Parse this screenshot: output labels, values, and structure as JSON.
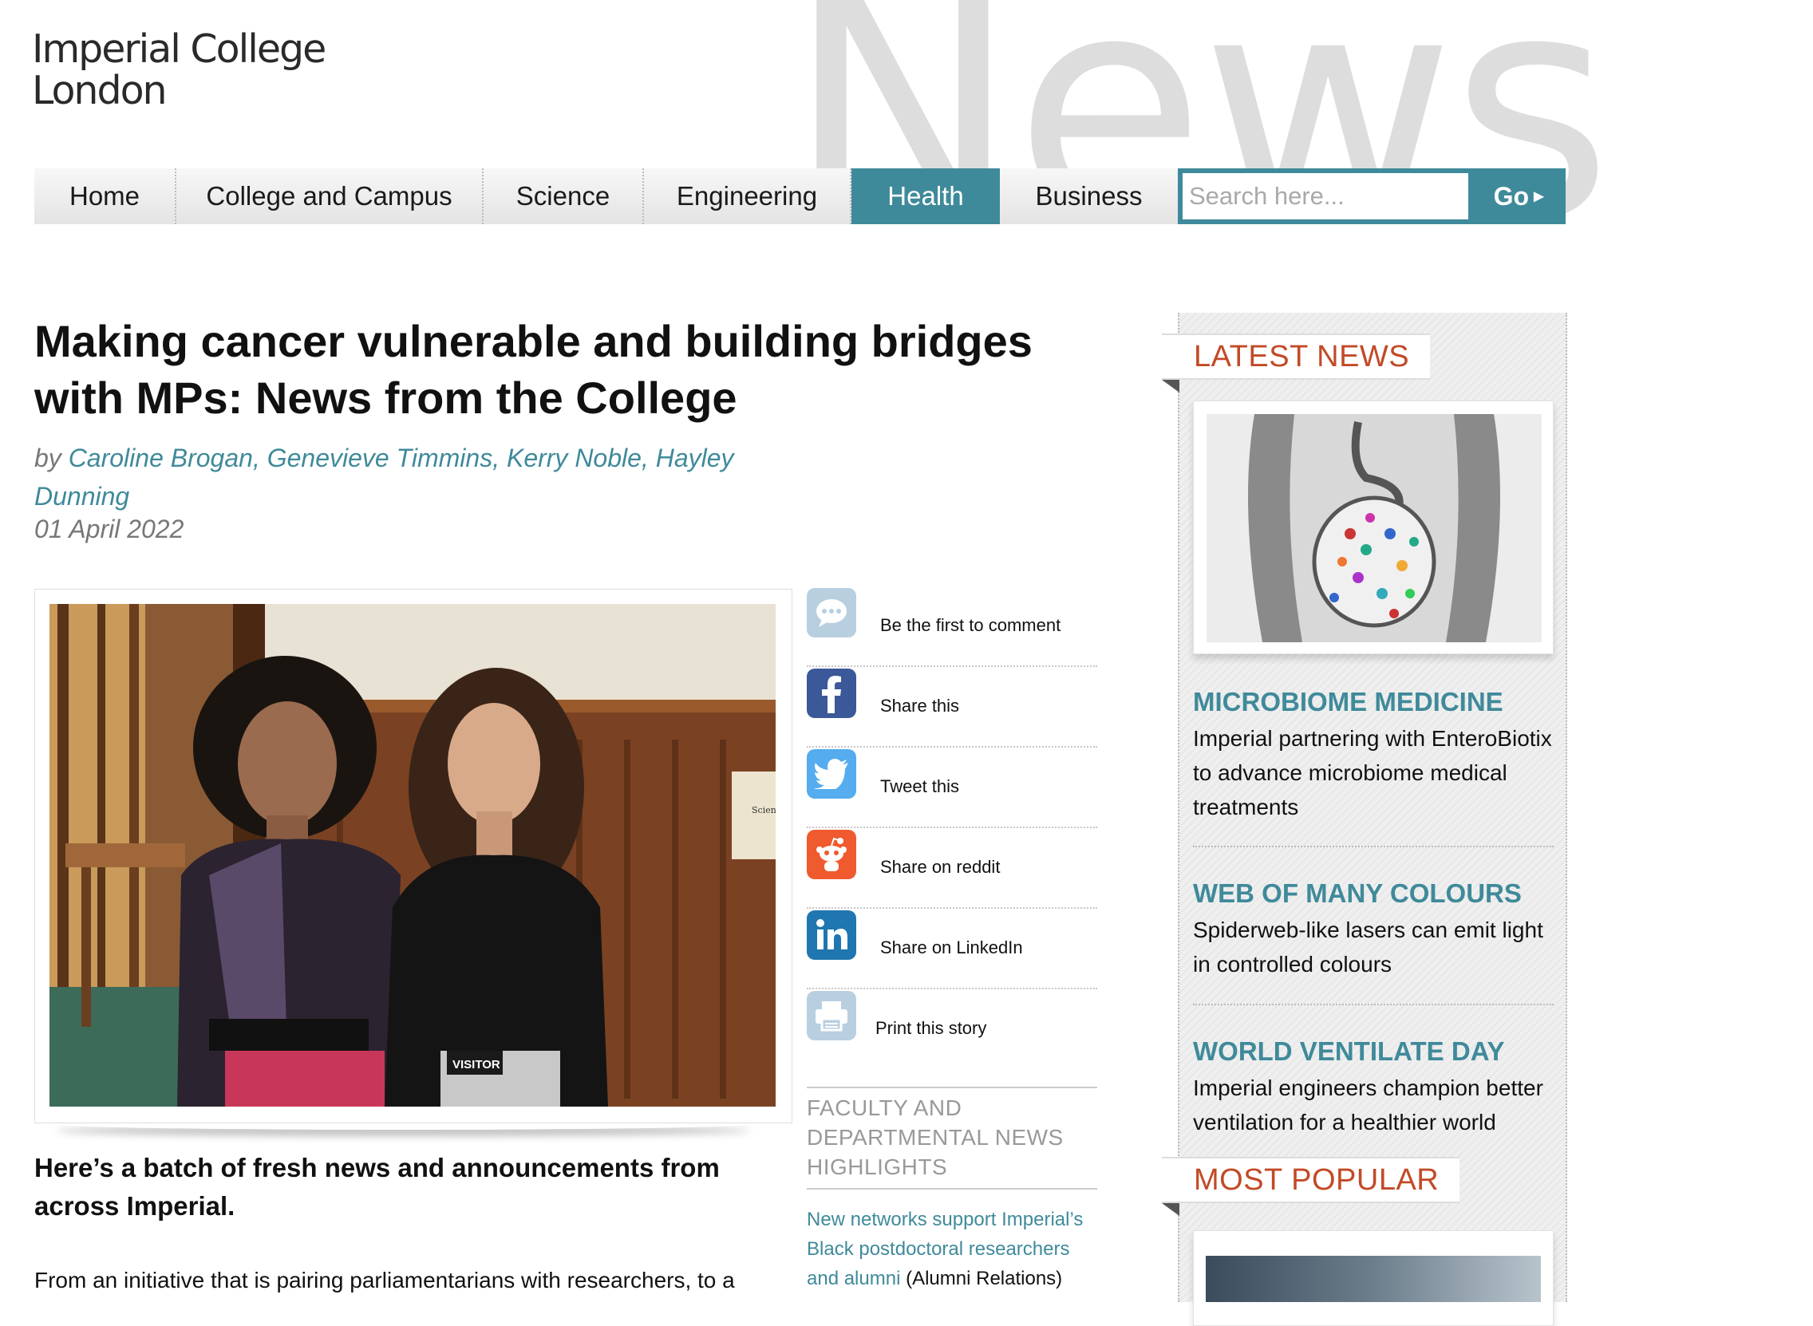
{
  "logo": {
    "line1": "Imperial College",
    "line2": "London"
  },
  "watermark": "News",
  "nav": {
    "items": [
      {
        "label": "Home",
        "active": false
      },
      {
        "label": "College and Campus",
        "active": false
      },
      {
        "label": "Science",
        "active": false
      },
      {
        "label": "Engineering",
        "active": false
      },
      {
        "label": "Health",
        "active": true
      },
      {
        "label": "Business",
        "active": false
      }
    ],
    "search_placeholder": "Search here...",
    "go_label": "Go",
    "go_icon": "triangle-right-icon"
  },
  "article": {
    "title": "Making cancer vulnerable and building bridges with MPs: News from the College",
    "by": "by ",
    "authors": "Caroline Brogan, Genevieve Timmins, Kerry Noble, Hayley Dunning",
    "date": "01 April 2022",
    "photo_badge": "VISITOR",
    "photo_sign": "Science and Technology",
    "lede": "Here’s a batch of fresh news and announcements from across Imperial.",
    "body_start": "From an initiative that is pairing parliamentarians with researchers, to a"
  },
  "share": [
    {
      "label": "Be the first to comment",
      "icon": "comment-icon",
      "color": "#b8cfe0"
    },
    {
      "label": "Share this",
      "icon": "facebook-icon",
      "color": "#3b5998"
    },
    {
      "label": "Tweet this",
      "icon": "twitter-icon",
      "color": "#55acee"
    },
    {
      "label": "Share on reddit",
      "icon": "reddit-icon",
      "color": "#ef5a2f"
    },
    {
      "label": "Share on LinkedIn",
      "icon": "linkedin-icon",
      "color": "#1f76b0"
    },
    {
      "label": "Print this story",
      "icon": "print-icon",
      "color": "#b8cfe0"
    }
  ],
  "faculty": {
    "heading": "FACULTY AND DEPARTMENTAL NEWS HIGHLIGHTS",
    "link_text": "New networks support Imperial’s Black postdoctoral researchers and alumni",
    "link_suffix": " (Alumni Relations)"
  },
  "sidebar": {
    "latest_heading": "LATEST NEWS",
    "popular_heading": "MOST POPULAR",
    "items": [
      {
        "heading": "MICROBIOME MEDICINE",
        "desc": "Imperial partnering with EnteroBiotix to advance microbiome medical treatments"
      },
      {
        "heading": "WEB OF MANY COLOURS",
        "desc": "Spiderweb-like lasers can emit light in controlled colours"
      },
      {
        "heading": "WORLD VENTILATE DAY",
        "desc": "Imperial engineers champion better ventilation for a healthier world"
      }
    ]
  },
  "colors": {
    "accent": "#3f8a9a",
    "section_heading": "#c24a26",
    "link": "#3f8a9a"
  }
}
